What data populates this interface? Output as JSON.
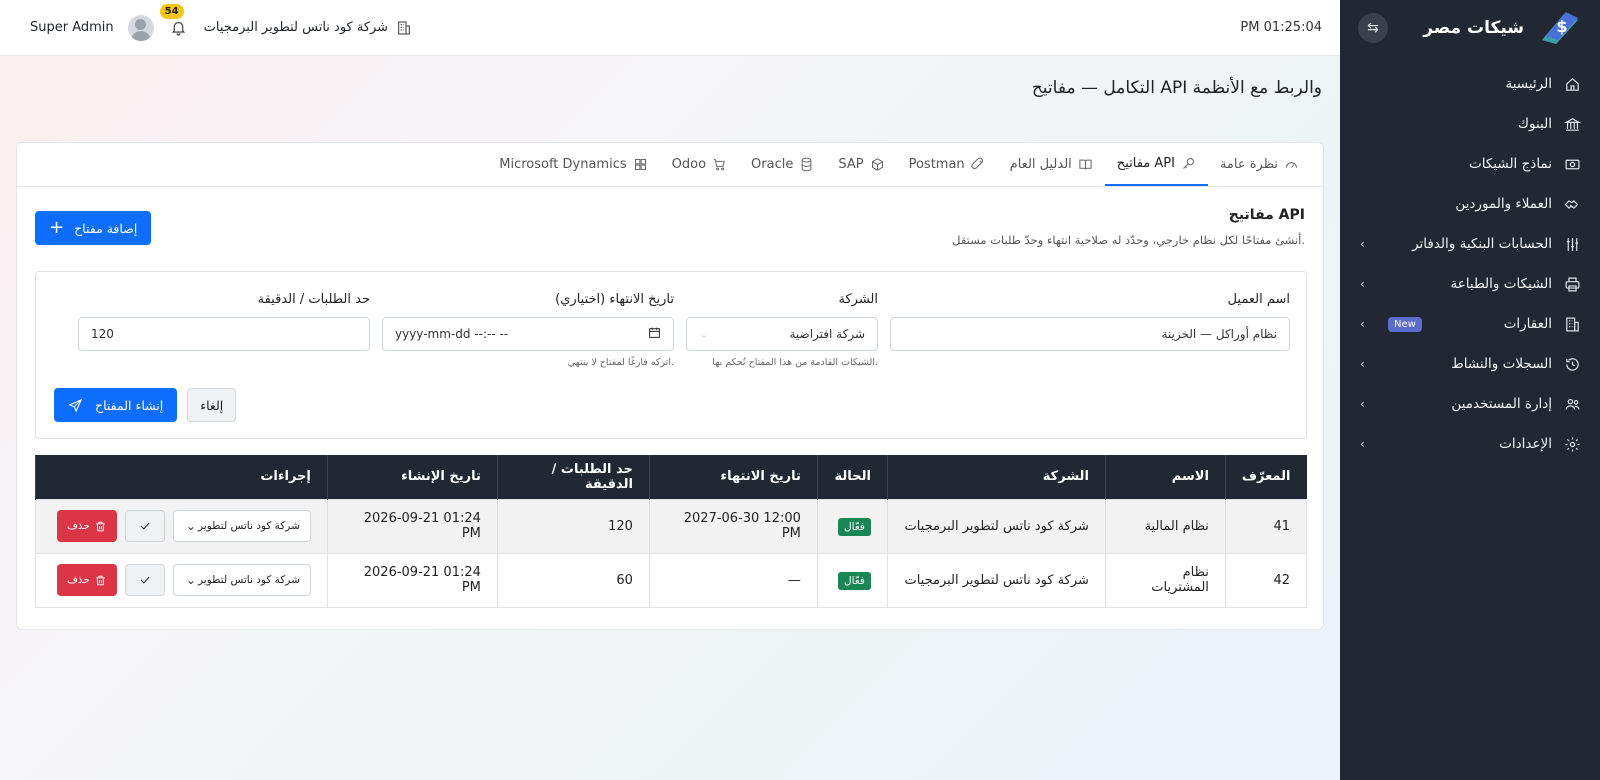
{
  "sidebar": {
    "brand": "شيكات مصر",
    "items": [
      {
        "label": "الرئيسية",
        "icon": "home-icon",
        "has_children": false
      },
      {
        "label": "البنوك",
        "icon": "bank-icon",
        "has_children": false
      },
      {
        "label": "نماذج الشيكات",
        "icon": "cash-icon",
        "has_children": false
      },
      {
        "label": "العملاء والموردين",
        "icon": "handshake-icon",
        "has_children": false
      },
      {
        "label": "الحسابات البنكية والدفاتر",
        "icon": "sliders-icon",
        "has_children": true
      },
      {
        "label": "الشيكات والطباعة",
        "icon": "printer-icon",
        "has_children": true
      },
      {
        "label": "العقارات",
        "icon": "building-icon",
        "has_children": true,
        "badge": "New"
      },
      {
        "label": "السجلات والنشاط",
        "icon": "history-icon",
        "has_children": true
      },
      {
        "label": "إدارة المستخدمين",
        "icon": "users-icon",
        "has_children": true
      },
      {
        "label": "الإعدادات",
        "icon": "gear-icon",
        "has_children": true
      }
    ]
  },
  "topbar": {
    "clock": "PM 01:25:04",
    "company": "شركة كود ناتس لتطوير البرمجيات",
    "notifications": "54",
    "user": "Super Admin"
  },
  "page_title": "التكامل — مفاتيح API والربط مع الأنظمة",
  "tabs": [
    {
      "label": "نظرة عامة",
      "icon": "gauge-icon",
      "active": false
    },
    {
      "label": "مفاتيح API",
      "icon": "key-icon",
      "active": true
    },
    {
      "label": "الدليل العام",
      "icon": "book-icon",
      "active": false
    },
    {
      "label": "Postman",
      "icon": "rocket-icon",
      "active": false
    },
    {
      "label": "SAP",
      "icon": "box-icon",
      "active": false
    },
    {
      "label": "Oracle",
      "icon": "database-icon",
      "active": false
    },
    {
      "label": "Odoo",
      "icon": "cart-icon",
      "active": false
    },
    {
      "label": "Microsoft Dynamics",
      "icon": "grid-icon",
      "active": false
    }
  ],
  "section": {
    "title": "مفاتيح API",
    "subtitle": "أنشئ مفتاحًا لكل نظام خارجي، وحدّد له صلاحية انتهاء وحدّ طلبات مستقل.",
    "add_button": "إضافة مفتاح"
  },
  "form": {
    "client_name": {
      "label": "اسم العميل",
      "value": "نظام أوراكل — الخزينة"
    },
    "company": {
      "label": "الشركة",
      "value": "شركة افتراضية",
      "help": "الشيكات القادمة من هذا المفتاح تُحكم بها."
    },
    "expiry": {
      "label": "تاريخ الانتهاء (اختياري)",
      "placeholder": "yyyy-mm-dd --:-- --",
      "help": "اتركه فارغًا لمفتاح لا ينتهي."
    },
    "rate_limit": {
      "label": "حد الطلبات / الدقيقة",
      "value": "120"
    },
    "cancel": "إلغاء",
    "submit": "إنشاء المفتاح"
  },
  "table": {
    "headers": [
      "المعرّف",
      "الاسم",
      "الشركة",
      "الحالة",
      "تاريخ الانتهاء",
      "حد الطلبات / الدقيقة",
      "تاريخ الإنشاء",
      "إجراءات"
    ],
    "rows": [
      {
        "id": "41",
        "name": "نظام المالية",
        "company": "شركة كود ناتس لتطوير البرمجيات",
        "status": "فعّال",
        "expiry": "2027-06-30 12:00 PM",
        "rate": "120",
        "created": "2026-09-21 01:24 PM",
        "select": "شركة كود ناتس لتطوير",
        "delete": "حذف"
      },
      {
        "id": "42",
        "name": "نظام المشتريات",
        "company": "شركة كود ناتس لتطوير البرمجيات",
        "status": "فعّال",
        "expiry": "—",
        "rate": "60",
        "created": "2026-09-21 01:24 PM",
        "select": "شركة كود ناتس لتطوير",
        "delete": "حذف"
      }
    ]
  },
  "colors": {
    "sidebar_bg": "#212833",
    "primary": "#0d6efd",
    "danger": "#dc3545",
    "success": "#198754",
    "badge_yellow": "#f5c518",
    "badge_new": "#5b6bcf"
  }
}
